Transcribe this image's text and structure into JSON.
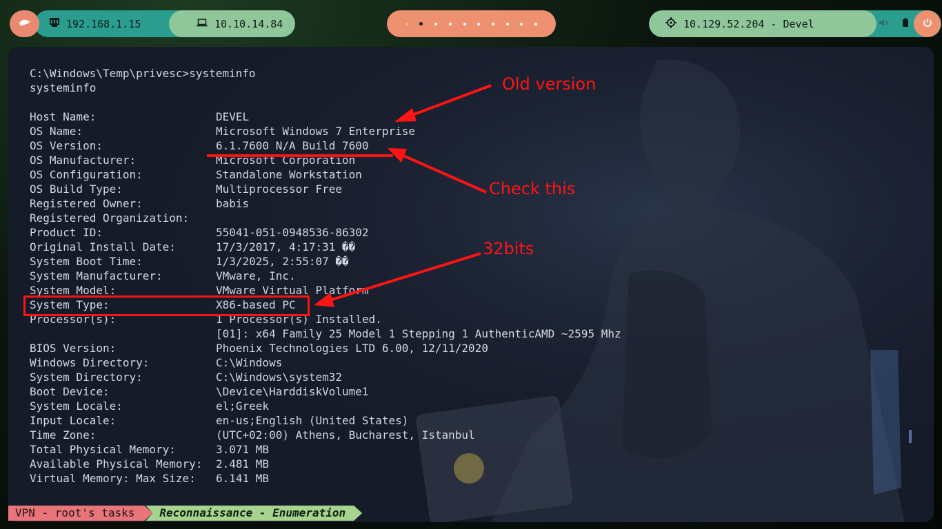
{
  "topbar": {
    "local_ip": "192.168.1.15",
    "vpn_ip": "10.10.14.84",
    "target_label": "10.129.52.204 - Devel"
  },
  "terminal": {
    "lines": [
      {
        "text": "C:\\Windows\\Temp\\privesc>systeminfo"
      },
      {
        "text": "systeminfo"
      },
      {
        "text": ""
      },
      {
        "key": "Host Name:",
        "value": "DEVEL"
      },
      {
        "key": "OS Name:",
        "value": "Microsoft Windows 7 Enterprise"
      },
      {
        "key": "OS Version:",
        "value": "6.1.7600 N/A Build 7600"
      },
      {
        "key": "OS Manufacturer:",
        "value": "Microsoft Corporation"
      },
      {
        "key": "OS Configuration:",
        "value": "Standalone Workstation"
      },
      {
        "key": "OS Build Type:",
        "value": "Multiprocessor Free"
      },
      {
        "key": "Registered Owner:",
        "value": "babis"
      },
      {
        "key": "Registered Organization:",
        "value": ""
      },
      {
        "key": "Product ID:",
        "value": "55041-051-0948536-86302"
      },
      {
        "key": "Original Install Date:",
        "value": "17/3/2017, 4:17:31 ��"
      },
      {
        "key": "System Boot Time:",
        "value": "1/3/2025, 2:55:07 ��"
      },
      {
        "key": "System Manufacturer:",
        "value": "VMware, Inc."
      },
      {
        "key": "System Model:",
        "value": "VMware Virtual Platform"
      },
      {
        "key": "System Type:",
        "value": "X86-based PC"
      },
      {
        "key": "Processor(s):",
        "value": "1 Processor(s) Installed."
      },
      {
        "key": "",
        "value": "[01]: x64 Family 25 Model 1 Stepping 1 AuthenticAMD ~2595 Mhz"
      },
      {
        "key": "BIOS Version:",
        "value": "Phoenix Technologies LTD 6.00, 12/11/2020"
      },
      {
        "key": "Windows Directory:",
        "value": "C:\\Windows"
      },
      {
        "key": "System Directory:",
        "value": "C:\\Windows\\system32"
      },
      {
        "key": "Boot Device:",
        "value": "\\Device\\HarddiskVolume1"
      },
      {
        "key": "System Locale:",
        "value": "el;Greek"
      },
      {
        "key": "Input Locale:",
        "value": "en-us;English (United States)"
      },
      {
        "key": "Time Zone:",
        "value": "(UTC+02:00) Athens, Bucharest, Istanbul"
      },
      {
        "key": "Total Physical Memory:",
        "value": "3.071 MB"
      },
      {
        "key": "Available Physical Memory:",
        "value": "2.481 MB"
      },
      {
        "key": "Virtual Memory: Max Size:",
        "value": "6.141 MB"
      }
    ]
  },
  "annotations": {
    "old_version": "Old version",
    "check_this": "Check this",
    "bits": "32bits",
    "color": "#ff1414"
  },
  "statusbar": {
    "session": "VPN - root's tasks",
    "window": "Reconnaissance - Enumeration"
  },
  "colors": {
    "accent_orange": "#ee9170",
    "accent_teal": "#2a9d8f",
    "accent_green": "#8fc79a",
    "terminal_bg": "#161b29"
  },
  "icons": [
    "menu-icon",
    "network-icon",
    "laptop-icon",
    "crosshair-icon",
    "volume-icon",
    "battery-icon",
    "power-icon"
  ]
}
